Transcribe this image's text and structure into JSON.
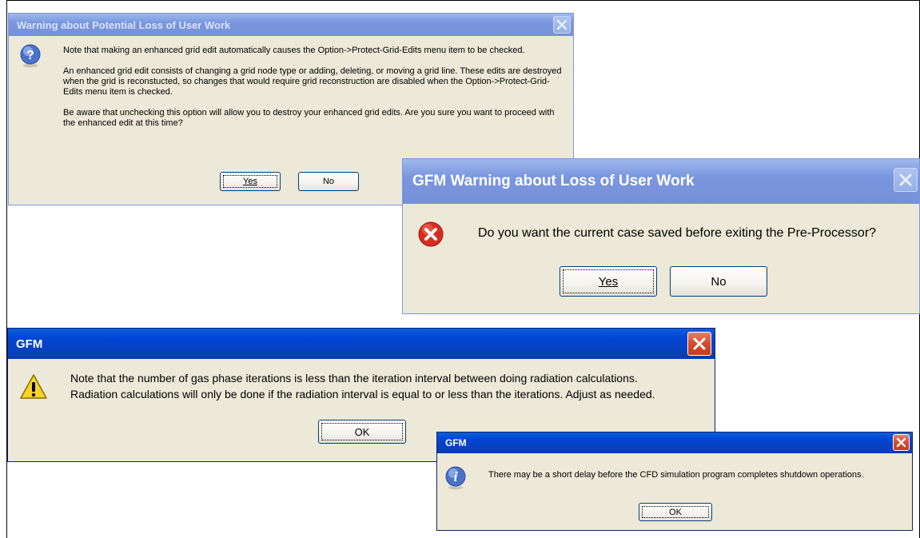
{
  "dialog1": {
    "title": "Warning about Potential Loss of User Work",
    "icon": "question-icon",
    "paragraphs": [
      "Note that making an enhanced grid edit automatically causes the Option->Protect-Grid-Edits menu item to be checked.",
      "An enhanced grid edit consists of changing a grid node type or adding, deleting, or moving a grid line.  These edits are destroyed when the grid is reconstucted, so changes that would require grid reconstruction are disabled when the Option->Protect-Grid-Edits menu item is checked.",
      "Be aware that unchecking this option will allow you to destroy your enhanced grid edits.  Are you sure you want to proceed with the enhanced edit at this time?"
    ],
    "yes_label": "Yes",
    "no_label": "No"
  },
  "dialog2": {
    "title": "GFM Warning about Loss of User Work",
    "icon": "error-icon",
    "message": "Do you want the current case saved before exiting the Pre-Processor?",
    "yes_label": "Yes",
    "no_label": "No"
  },
  "dialog3": {
    "title": "GFM",
    "icon": "warning-icon",
    "message_lines": [
      "Note that the number of gas phase iterations is less than the iteration interval between doing radiation calculations.",
      "Radiation calculations will only be done if the radiation interval is equal to or less than the iterations.  Adjust as needed."
    ],
    "ok_label": "OK"
  },
  "dialog4": {
    "title": "GFM",
    "icon": "info-icon",
    "message": "There may be a short delay before the CFD simulation program completes shutdown operations.",
    "ok_label": "OK"
  },
  "colors": {
    "active_title": "#0046d5",
    "inactive_title": "#7a96df",
    "dialog_face": "#ece9d8",
    "close_red": "#d64a2c"
  }
}
